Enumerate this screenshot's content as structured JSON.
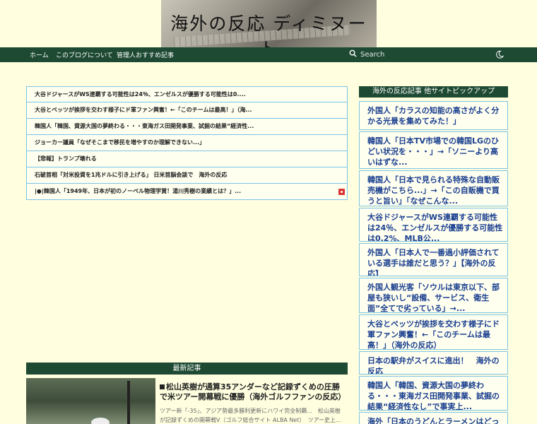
{
  "header": {
    "site_title": "海外の反応 ディミヌート"
  },
  "nav": {
    "items": [
      {
        "label": "ホーム"
      },
      {
        "label": "このブログについて"
      },
      {
        "label": "管理人おすすめ記事"
      }
    ],
    "search_placeholder": "Search"
  },
  "ranking": [
    "大谷ドジャースがWS連覇する可能性は24％、エンゼルスが優勝する可能性は0....",
    "大谷とベッツが挨拶を交わす様子にド軍ファン興奮！←「このチームは最高！」（海...",
    "韓国人「韓国、資源大国の夢終わる・・・東海ガス田開発事業、試掘の結果“経済性...",
    "ジョーカー議員「なぜそこまで移民を増やすのか理解できない...」",
    "【悲報】トランプ壊れる",
    "石破首相「対米投資を1兆ドルに引き上げる」 日米首脳会談で　海外の反応",
    "|●|韓国人「1949年、日本が初のノーベル物理学賞！湯川秀樹の業績とは？」..."
  ],
  "latest": {
    "header": "最新記事",
    "title": "松山英樹が通算35アンダーなど記録ずくめの圧勝で米ツアー開幕戦に優勝（海外ゴルフファンの反応）",
    "excerpt": "ツアー新「-35」、アジア勢最多勝利更新にハワイ完全制覇...　松山英樹が記録ずくめの開幕戦V（ゴルフ総合サイト ALBA Net）　ツアー史上..."
  },
  "sidebar": {
    "header": "海外の反応記事 他サイトピックアップ",
    "items": [
      "外国人「カラスの知能の高さがよく分かる光景を集めてみた！」",
      "韓国人「日本TV市場での韓国LGのひどい状況を・・・」→「ソニーより高いはずな...",
      "韓国人「日本で見られる特殊な自動販売機がこちら...」→「この自販機で買うと旨い」「なぜこんな...",
      "大谷ドジャースがWS連覇する可能性は24％、エンゼルスが優勝する可能性は0.2%、MLB公...",
      "外国人「日本人で一番過小評価されている選手は誰だと思う？」【海外の反応】",
      "外国人観光客「ソウルは東京以下、部屋も狭いし“設備、サービス、衛生面”全てで劣っている」→...",
      "大谷とベッツが挨拶を交わす様子にド軍ファン興奮！←「このチームは最高！」（海外の反応）",
      "日本の駅弁がスイスに進出！　海外の反応",
      "韓国人「韓国、資源大国の夢終わる・・・東海ガス田開発事業、試掘の結果“経済性なし”で事実上...",
      "海外「日本のうどんとラーメンはどっちが旨い？」日本の麺料理に対する海外の反応"
    ]
  }
}
